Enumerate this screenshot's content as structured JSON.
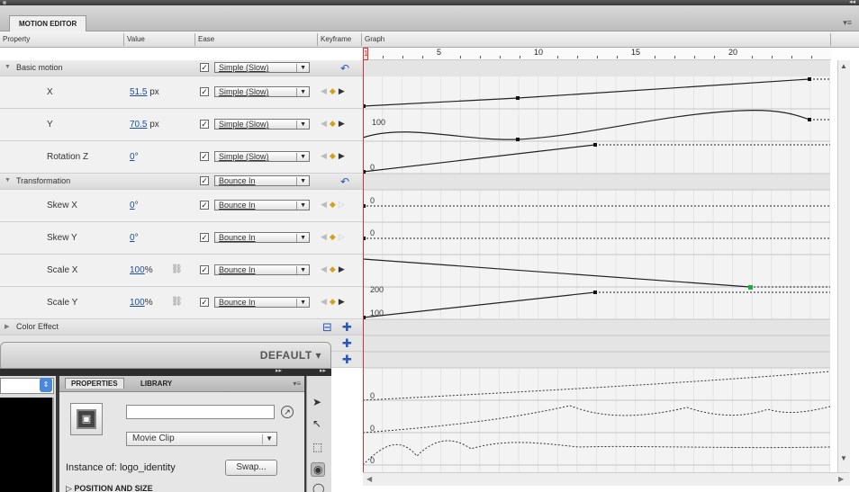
{
  "panel": {
    "title": "MOTION EDITOR"
  },
  "columns": {
    "property": "Property",
    "value": "Value",
    "ease": "Ease",
    "keyframe": "Keyframe",
    "graph": "Graph"
  },
  "ruler": {
    "playhead": "1",
    "labels": [
      "5",
      "10",
      "15",
      "20"
    ]
  },
  "sections": [
    {
      "name": "Basic motion",
      "ease": "Simple (Slow)"
    },
    {
      "name": "Transformation",
      "ease": "Bounce In"
    },
    {
      "name": "Color Effect"
    }
  ],
  "properties": [
    {
      "name": "X",
      "value": "51.5",
      "unit": "px",
      "ease": "Simple (Slow)"
    },
    {
      "name": "Y",
      "value": "70.5",
      "unit": "px",
      "ease": "Simple (Slow)"
    },
    {
      "name": "Rotation Z",
      "value": "0",
      "unit": "°",
      "ease": "Simple (Slow)"
    },
    {
      "name": "Skew X",
      "value": "0",
      "unit": "°",
      "ease": "Bounce In"
    },
    {
      "name": "Skew Y",
      "value": "0",
      "unit": "°",
      "ease": "Bounce In"
    },
    {
      "name": "Scale X",
      "value": "100",
      "unit": "%",
      "ease": "Bounce In"
    },
    {
      "name": "Scale Y",
      "value": "100",
      "unit": "%",
      "ease": "Bounce In"
    }
  ],
  "graph_labels": {
    "y_100": "100",
    "rot_0": "0",
    "skewx_0": "0",
    "skewy_0": "0",
    "scale_200": "200",
    "scale_100": "100",
    "e1": "0",
    "e2": "0",
    "e3": "0"
  },
  "workspace": {
    "label": "DEFAULT ▾"
  },
  "properties_panel": {
    "tab_properties": "PROPERTIES",
    "tab_library": "LIBRARY",
    "instance_name_placeholder": "",
    "symbol_type": "Movie Clip",
    "instance_of_label": "Instance of:",
    "instance_of_value": "logo_identity",
    "swap_label": "Swap...",
    "section_position": "▷ POSITION AND SIZE"
  },
  "icons": {
    "reset": "reset-icon",
    "add": "add-icon",
    "checkbox": "checkbox-icon"
  },
  "colors": {
    "playhead": "#d33333",
    "keyframe_active": "#22aa44",
    "link": "#1a4fa0"
  }
}
